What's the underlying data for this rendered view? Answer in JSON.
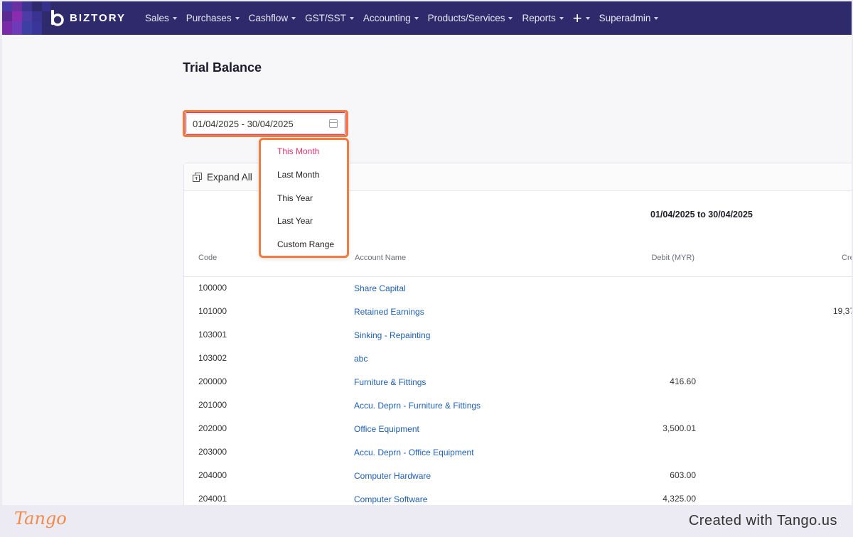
{
  "brand": {
    "name": "BIZTORY",
    "primary_color": "#2e2a6b",
    "accent_color": "#f57a3d",
    "active_color": "#e0336a"
  },
  "nav": [
    {
      "label": "Sales"
    },
    {
      "label": "Purchases"
    },
    {
      "label": "Cashflow"
    },
    {
      "label": "GST/SST"
    },
    {
      "label": "Accounting"
    },
    {
      "label": "Products/Services"
    },
    {
      "label": "Reports"
    },
    {
      "label": "+"
    },
    {
      "label": "Superadmin"
    }
  ],
  "page": {
    "title": "Trial Balance"
  },
  "date_filter": {
    "value": "01/04/2025 - 30/04/2025",
    "icon": "calendar-icon"
  },
  "range_menu": {
    "options": [
      "This Month",
      "Last Month",
      "This Year",
      "Last Year",
      "Custom Range"
    ],
    "selected": "This Month"
  },
  "toolbar": {
    "expand_label": "Expand All",
    "icon": "expand-all-icon"
  },
  "table": {
    "period_label": "01/04/2025 to 30/04/2025",
    "columns": {
      "code": "Code",
      "account": "Account Name",
      "debit": "Debit (MYR)",
      "credit": "Cre"
    },
    "rows": [
      {
        "code": "100000",
        "account": "Share Capital",
        "debit": "",
        "credit": ""
      },
      {
        "code": "101000",
        "account": "Retained Earnings",
        "debit": "",
        "credit": "19,37"
      },
      {
        "code": "103001",
        "account": "Sinking - Repainting",
        "debit": "",
        "credit": ""
      },
      {
        "code": "103002",
        "account": "abc",
        "debit": "",
        "credit": ""
      },
      {
        "code": "200000",
        "account": "Furniture & Fittings",
        "debit": "416.60",
        "credit": ""
      },
      {
        "code": "201000",
        "account": "Accu. Deprn - Furniture & Fittings",
        "debit": "",
        "credit": ""
      },
      {
        "code": "202000",
        "account": "Office Equipment",
        "debit": "3,500.01",
        "credit": ""
      },
      {
        "code": "203000",
        "account": "Accu. Deprn - Office Equipment",
        "debit": "",
        "credit": ""
      },
      {
        "code": "204000",
        "account": "Computer Hardware",
        "debit": "603.00",
        "credit": ""
      },
      {
        "code": "204001",
        "account": "Computer Software",
        "debit": "4,325.00",
        "credit": ""
      }
    ]
  },
  "footer": {
    "logo": "Tango",
    "credit": "Created with Tango.us"
  }
}
